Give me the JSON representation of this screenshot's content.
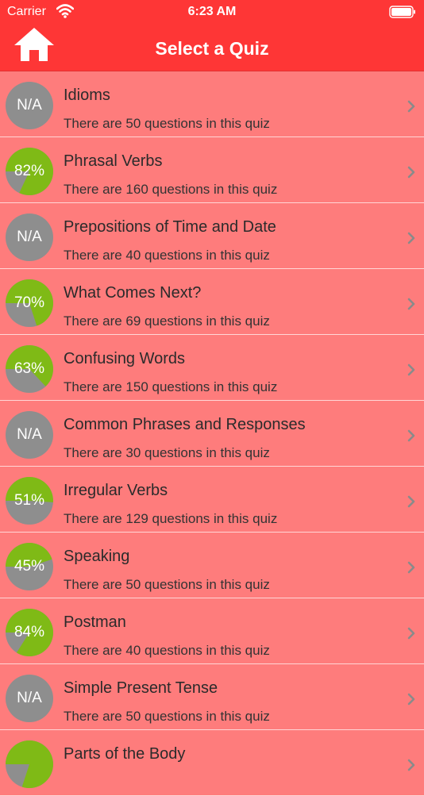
{
  "status": {
    "carrier": "Carrier",
    "time": "6:23 AM"
  },
  "nav": {
    "title": "Select a Quiz"
  },
  "colors": {
    "nav": "#fe3636",
    "row": "#fe7c7c",
    "score": "#7fba16",
    "empty": "#8e8e8e"
  },
  "quizzes": [
    {
      "title": "Idioms",
      "subtitle": "There are 50 questions in this quiz",
      "score": "N/A",
      "fraction": 0
    },
    {
      "title": "Phrasal Verbs",
      "subtitle": "There are 160 questions in this quiz",
      "score": "82%",
      "fraction": 0.82
    },
    {
      "title": "Prepositions of Time and Date",
      "subtitle": "There are 40 questions in this quiz",
      "score": "N/A",
      "fraction": 0
    },
    {
      "title": "What Comes Next?",
      "subtitle": "There are 69 questions in this quiz",
      "score": "70%",
      "fraction": 0.7
    },
    {
      "title": "Confusing Words",
      "subtitle": "There are 150 questions in this quiz",
      "score": "63%",
      "fraction": 0.63
    },
    {
      "title": "Common Phrases and Responses",
      "subtitle": "There are 30 questions in this quiz",
      "score": "N/A",
      "fraction": 0
    },
    {
      "title": "Irregular Verbs",
      "subtitle": "There are 129 questions in this quiz",
      "score": "51%",
      "fraction": 0.51
    },
    {
      "title": "Speaking",
      "subtitle": "There are 50 questions in this quiz",
      "score": "45%",
      "fraction": 0.45
    },
    {
      "title": "Postman",
      "subtitle": "There are 40 questions in this quiz",
      "score": "84%",
      "fraction": 0.84
    },
    {
      "title": "Simple Present Tense",
      "subtitle": "There are 50 questions in this quiz",
      "score": "N/A",
      "fraction": 0
    },
    {
      "title": "Parts of the Body",
      "subtitle": "",
      "score": "",
      "fraction": 0.8
    }
  ]
}
